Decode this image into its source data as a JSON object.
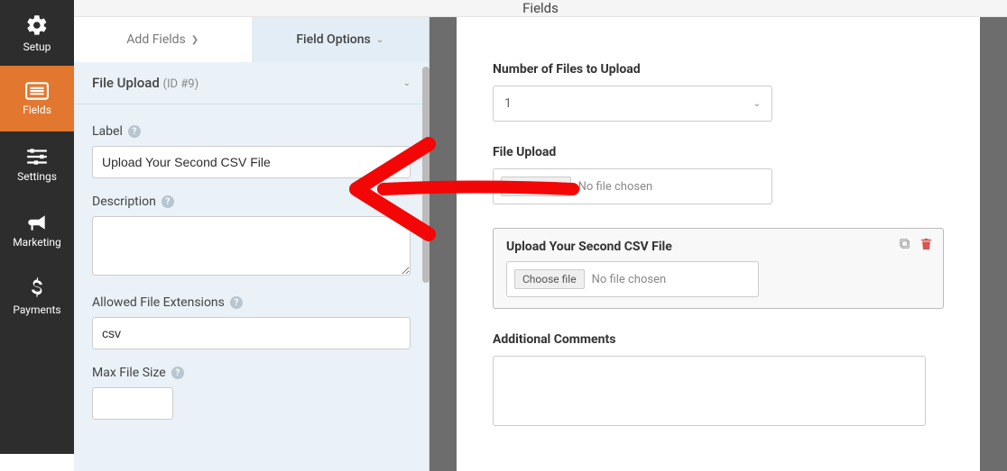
{
  "sidebar": {
    "items": [
      {
        "label": "Setup",
        "icon": "gear"
      },
      {
        "label": "Fields",
        "icon": "list",
        "active": true
      },
      {
        "label": "Settings",
        "icon": "sliders"
      },
      {
        "label": "Marketing",
        "icon": "bullhorn"
      },
      {
        "label": "Payments",
        "icon": "dollar"
      }
    ]
  },
  "topbar": {
    "title": "Fields"
  },
  "tabs": {
    "add": "Add Fields",
    "options": "Field Options"
  },
  "section": {
    "title": "File Upload",
    "id": "(ID #9)"
  },
  "options": {
    "label_title": "Label",
    "label_value": "Upload Your Second CSV File",
    "description_title": "Description",
    "description_value": "",
    "allowed_ext_title": "Allowed File Extensions",
    "allowed_ext_value": "csv",
    "max_size_title": "Max File Size",
    "max_size_value": ""
  },
  "preview": {
    "num_files_label": "Number of Files to Upload",
    "num_files_value": "1",
    "file_upload_label": "File Upload",
    "choose_btn": "Choose file",
    "no_file": "No file chosen",
    "selected_label": "Upload Your Second CSV File",
    "comments_label": "Additional Comments"
  }
}
